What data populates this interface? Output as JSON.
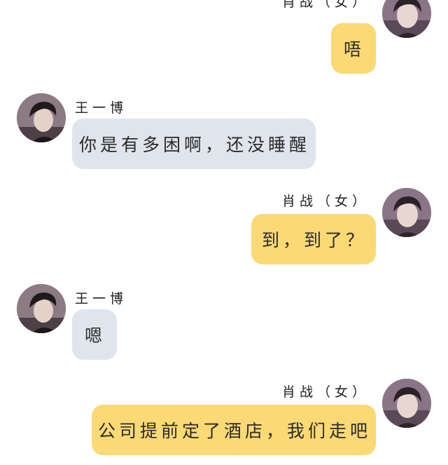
{
  "colors": {
    "self_bubble": "#fbd974",
    "other_bubble": "#e0e5ed",
    "background": "#ffffff"
  },
  "messages": [
    {
      "sender": "self",
      "name": "肖战（女）",
      "text": "唔"
    },
    {
      "sender": "other",
      "name": "王一博",
      "text": "你是有多困啊，还没睡醒"
    },
    {
      "sender": "self",
      "name": "肖战（女）",
      "text": "到，到了？"
    },
    {
      "sender": "other",
      "name": "王一博",
      "text": "嗯"
    },
    {
      "sender": "self",
      "name": "肖战（女）",
      "text": "公司提前定了酒店，我们走吧"
    }
  ]
}
